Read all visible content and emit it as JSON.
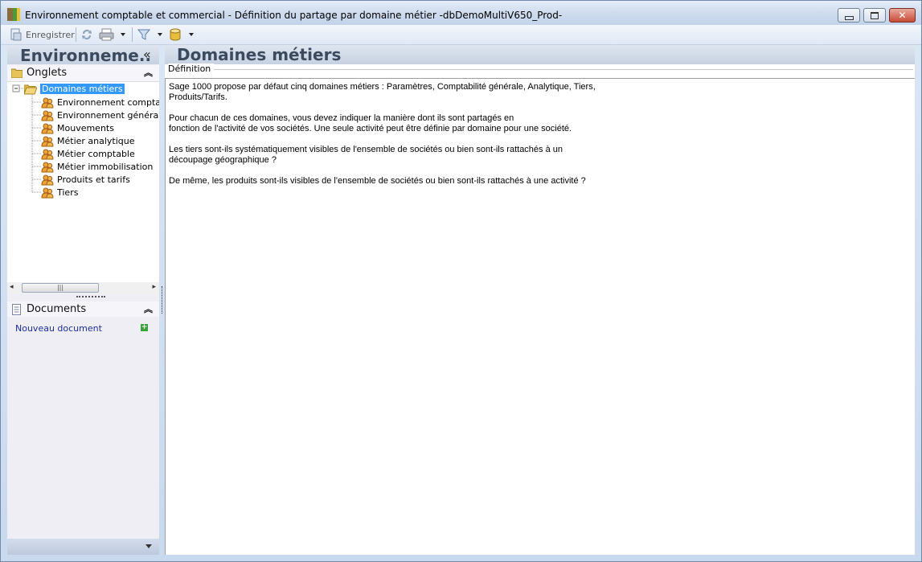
{
  "window": {
    "title": "Environnement comptable et commercial -  Définition du partage par domaine métier -dbDemoMultiV650_Prod-"
  },
  "toolbar": {
    "save_label": "Enregistrer"
  },
  "left_panel": {
    "header": "Environneme..",
    "collapse_glyph": "«",
    "onglets_label": "Onglets",
    "tree_root": "Domaines métiers",
    "tree_items": [
      "Environnement compta",
      "Environnement généra",
      "Mouvements",
      "Métier analytique",
      "Métier comptable",
      "Métier immobilisation",
      "Produits et tarifs",
      "Tiers"
    ],
    "documents_label": "Documents",
    "new_document_label": "Nouveau document"
  },
  "right_panel": {
    "header": "Domaines métiers",
    "group_label": "Définition",
    "definition_lines": [
      "Sage 1000 propose par défaut cinq domaines métiers : Paramètres, Comptabilité générale, Analytique, Tiers,",
      "Produits/Tarifs.",
      "Pour chacun de ces domaines, vous devez indiquer la manière dont ils sont partagés en",
      "fonction de l'activité de vos sociétés. Une seule activité peut être définie par domaine pour une société.",
      "Les tiers sont-ils systématiquement visibles de l'ensemble de sociétés ou bien sont-ils rattachés à un",
      "découpage géographique ?",
      "De même, les produits sont-ils visibles de l'ensemble de sociétés ou bien sont-ils rattachés à une activité ?"
    ]
  },
  "icons": {
    "app": "app-icon",
    "save": "save-icon",
    "refresh": "refresh-icon",
    "print": "print-icon",
    "filter": "filter-icon",
    "database": "database-icon",
    "folder": "folder-icon",
    "users": "users-icon",
    "document": "document-icon",
    "add": "add-icon"
  }
}
